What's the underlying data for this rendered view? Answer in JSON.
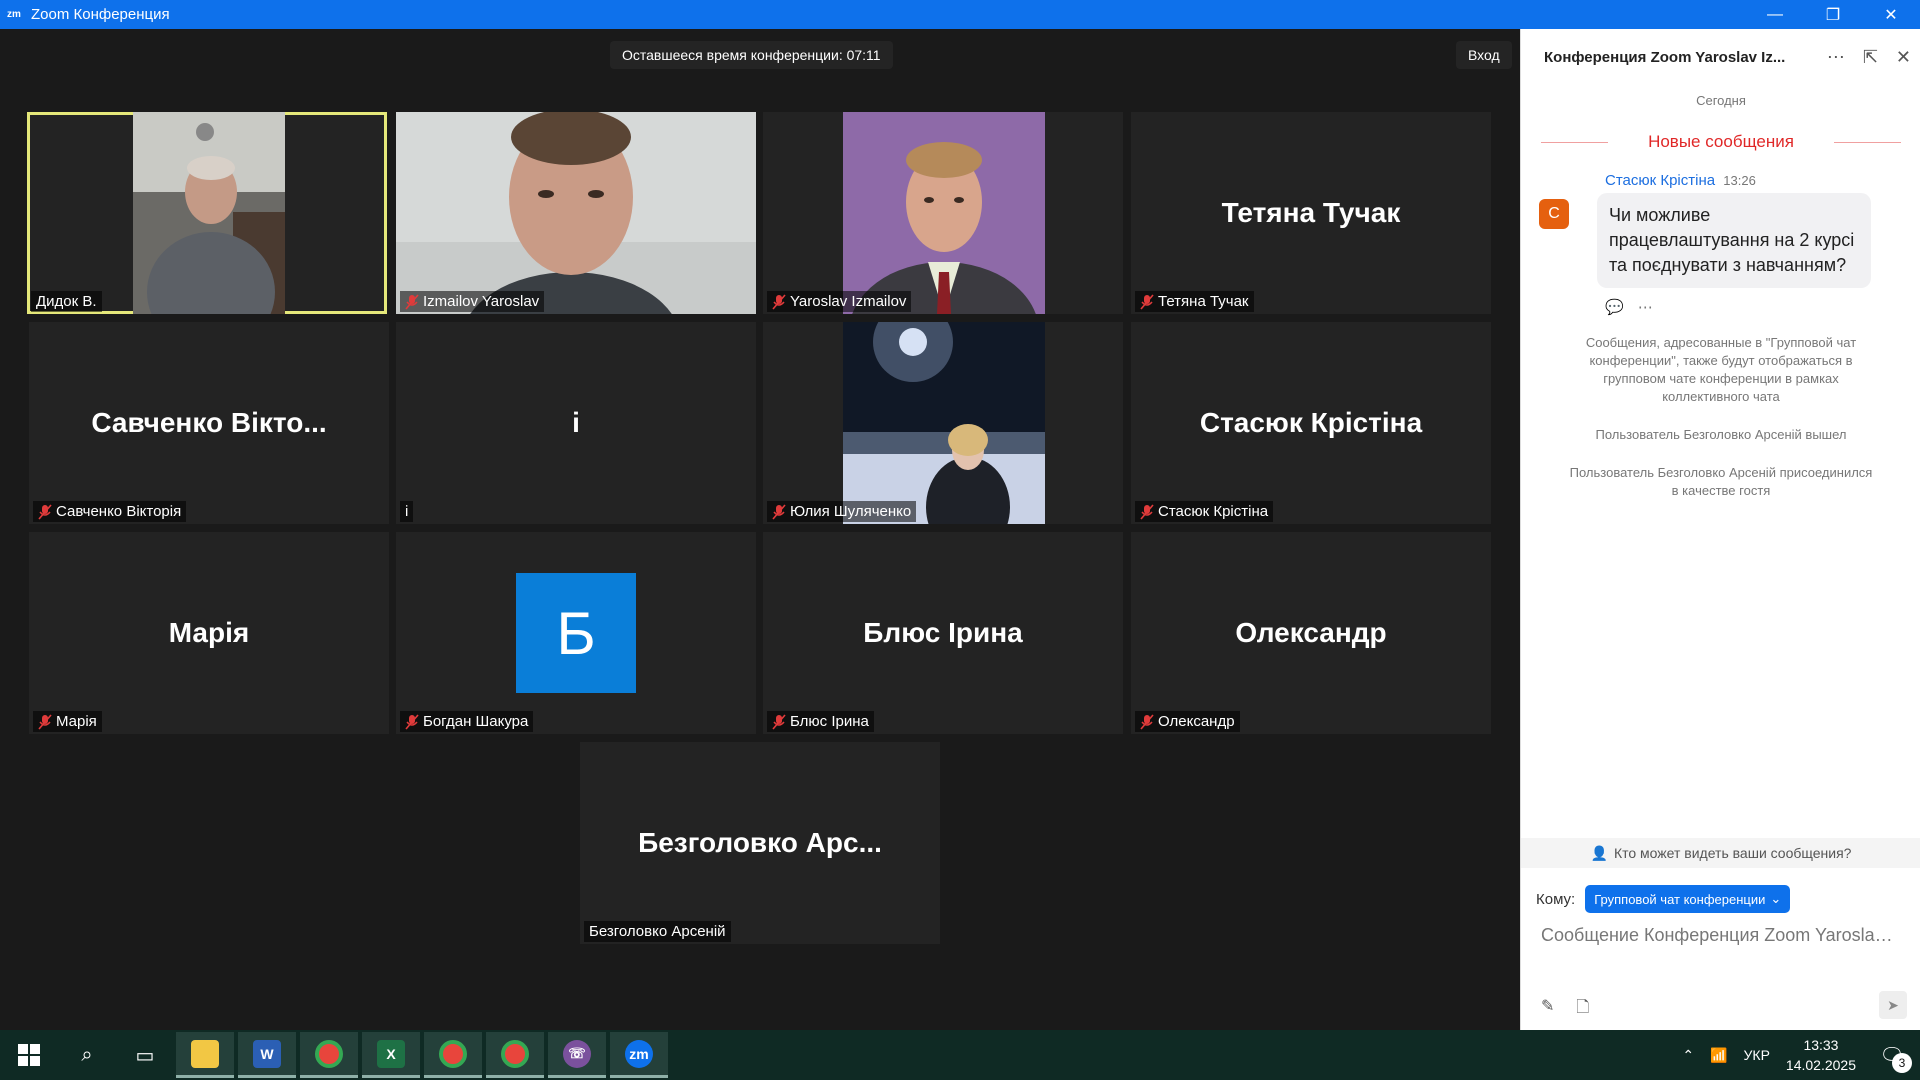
{
  "window": {
    "title": "Zoom Конференция",
    "logo_text": "zm",
    "controls": {
      "minimize": "—",
      "maximize": "❐",
      "close": "✕"
    }
  },
  "meeting": {
    "timer": "Оставшееся время конференции: 07:11",
    "enter_label": "Вход",
    "participants": [
      {
        "id": "p1",
        "label": "Дидок В.",
        "big": "",
        "muted": false,
        "video": true,
        "active": true
      },
      {
        "id": "p2",
        "label": "Izmailov Yaroslav",
        "big": "",
        "muted": true,
        "video": true
      },
      {
        "id": "p3",
        "label": "Yaroslav Izmailov",
        "big": "",
        "muted": true,
        "video": true
      },
      {
        "id": "p4",
        "label": "Тетяна Тучак",
        "big": "Тетяна Тучак",
        "muted": true,
        "video": false
      },
      {
        "id": "p5",
        "label": "Савченко Вікторія",
        "big": "Савченко Вікто...",
        "muted": true,
        "video": false
      },
      {
        "id": "p6",
        "label": "і",
        "big": "і",
        "muted": false,
        "video": false
      },
      {
        "id": "p7",
        "label": "Юлия Шуляченко",
        "big": "",
        "muted": true,
        "video": true
      },
      {
        "id": "p8",
        "label": "Стасюк Крістіна",
        "big": "Стасюк Крістіна",
        "muted": true,
        "video": false
      },
      {
        "id": "p9",
        "label": "Марія",
        "big": "Марія",
        "muted": true,
        "video": false
      },
      {
        "id": "p10",
        "label": "Богдан Шакура",
        "big": "Б",
        "muted": true,
        "video": false
      },
      {
        "id": "p11",
        "label": "Блюс Ірина",
        "big": "Блюс Ірина",
        "muted": true,
        "video": false
      },
      {
        "id": "p12",
        "label": "Олександр",
        "big": "Олександр",
        "muted": true,
        "video": false
      },
      {
        "id": "p13",
        "label": "Безголовко Арсеній",
        "big": "Безголовко  Арс...",
        "muted": false,
        "video": false
      }
    ]
  },
  "chat": {
    "title": "Конференция Zoom Yaroslav Iz...",
    "header_icons": [
      "more-icon",
      "popout-icon",
      "close-icon"
    ],
    "today": "Сегодня",
    "new_messages": "Новые сообщения",
    "message": {
      "avatar": "С",
      "sender": "Стасюк Крістіна",
      "time": "13:26",
      "text": "Чи можливе працевлаштування на 2 курсі та поєднувати з навчанням?",
      "actions": [
        "reply-icon",
        "more-icon"
      ]
    },
    "system_messages": [
      "Сообщения, адресованные в \"Групповой чат конференции\", также будут отображаться в групповом чате конференции в рамках коллективного чата",
      "Пользователь Безголовко Арсеній вышел",
      "Пользователь  Безголовко  Арсеній присоединился в качестве гостя"
    ],
    "who_can_see": "Кто может видеть ваши сообщения?",
    "to_label": "Кому:",
    "to_value": "Групповой чат конференции",
    "input_placeholder": "Сообщение Конференция Zoom Yaroslav Izmailov"
  },
  "taskbar": {
    "apps": [
      "file-explorer",
      "word",
      "chrome",
      "excel",
      "chrome",
      "chrome",
      "viber",
      "zoom"
    ],
    "language": "УКР",
    "time": "13:33",
    "date": "14.02.2025",
    "notifications": "3"
  },
  "colors": {
    "zoom_blue": "#0e71eb",
    "active_speaker": "#e5e87a",
    "new_messages_red": "#e02828",
    "avatar_orange": "#e5600f",
    "bogdan_avatar": "#0a7ed8"
  }
}
